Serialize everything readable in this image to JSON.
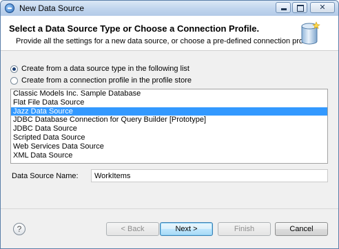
{
  "window": {
    "title": "New Data Source",
    "minimize_glyph": "",
    "maximize_glyph": "",
    "close_glyph": "✕"
  },
  "header": {
    "title": "Select a Data Source Type or Choose a Connection Profile.",
    "description": "Provide all the settings for a new data source, or choose a pre-defined connection profile."
  },
  "options": {
    "create_from_type": "Create from a data source type in the following list",
    "create_from_profile": "Create from a connection profile in the profile store",
    "selected": "create_from_type"
  },
  "list": {
    "items": [
      "Classic Models Inc. Sample Database",
      "Flat File Data Source",
      "Jazz Data Source",
      "JDBC Database Connection for Query Builder [Prototype]",
      "JDBC Data Source",
      "Scripted Data Source",
      "Web Services Data Source",
      "XML Data Source"
    ],
    "selected_index": 2
  },
  "name_field": {
    "label": "Data Source Name:",
    "value": "WorkItems"
  },
  "buttons": {
    "help": "?",
    "back": "< Back",
    "next": "Next >",
    "finish": "Finish",
    "cancel": "Cancel"
  },
  "colors": {
    "selection": "#3399ff",
    "title_bar": "#c2d6ee"
  },
  "icons": {
    "app": "eclipse-birt-icon",
    "header": "database-icon"
  }
}
